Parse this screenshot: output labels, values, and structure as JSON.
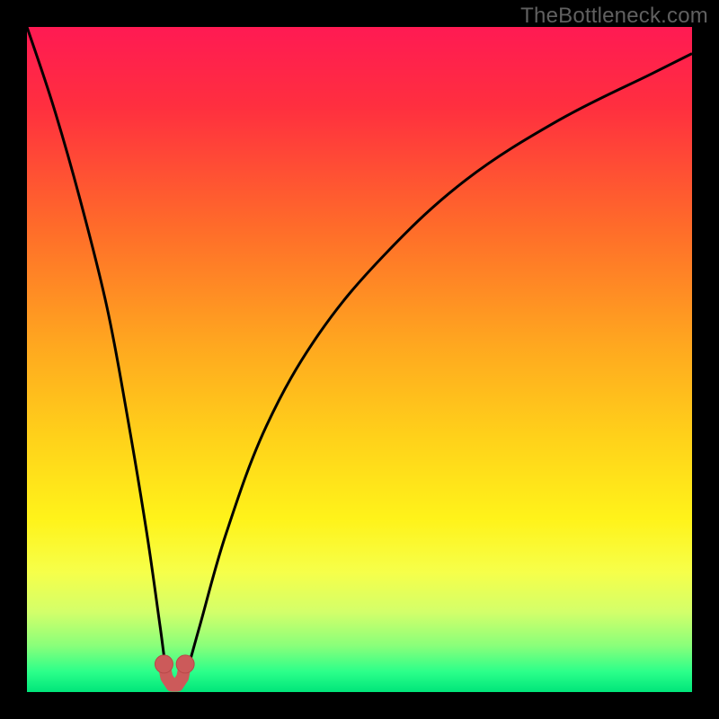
{
  "watermark": "TheBottleneck.com",
  "colors": {
    "frame": "#000000",
    "gradient_stops": [
      {
        "offset": 0.0,
        "color": "#ff1a53"
      },
      {
        "offset": 0.12,
        "color": "#ff2f3f"
      },
      {
        "offset": 0.3,
        "color": "#ff6b2a"
      },
      {
        "offset": 0.48,
        "color": "#ffa81f"
      },
      {
        "offset": 0.62,
        "color": "#ffd21a"
      },
      {
        "offset": 0.74,
        "color": "#fff31a"
      },
      {
        "offset": 0.82,
        "color": "#f6ff4a"
      },
      {
        "offset": 0.88,
        "color": "#d3ff6a"
      },
      {
        "offset": 0.93,
        "color": "#8aff7a"
      },
      {
        "offset": 0.97,
        "color": "#2bff8a"
      },
      {
        "offset": 1.0,
        "color": "#00e57a"
      }
    ],
    "curve_stroke": "#000000",
    "marker_fill": "#cc5a5a",
    "marker_stroke": "#b84848"
  },
  "chart_data": {
    "type": "line",
    "title": "",
    "xlabel": "",
    "ylabel": "",
    "xlim": [
      0,
      100
    ],
    "ylim": [
      0,
      100
    ],
    "note": "Axes unlabeled. x roughly 0–100 (% of plot width), y roughly 0–100 (bottleneck severity %). Curve dips to ~0 near x≈22 then rises.",
    "series": [
      {
        "name": "bottleneck-curve",
        "x": [
          0,
          4,
          8,
          12,
          15,
          18,
          20,
          21,
          22,
          23,
          24,
          26,
          30,
          36,
          44,
          54,
          66,
          80,
          94,
          100
        ],
        "y": [
          100,
          88,
          74,
          58,
          42,
          24,
          10,
          3,
          1,
          1,
          3,
          10,
          24,
          40,
          54,
          66,
          77,
          86,
          93,
          96
        ]
      }
    ],
    "markers": {
      "name": "highlight-points",
      "x": [
        20.6,
        23.8
      ],
      "y": [
        4.2,
        4.2
      ]
    },
    "marker_segment": {
      "name": "highlight-segment",
      "x": [
        20.6,
        21.0,
        21.8,
        22.2,
        22.6,
        23.4,
        23.8
      ],
      "y": [
        4.2,
        2.2,
        1.0,
        1.0,
        1.0,
        2.2,
        4.2
      ]
    }
  }
}
